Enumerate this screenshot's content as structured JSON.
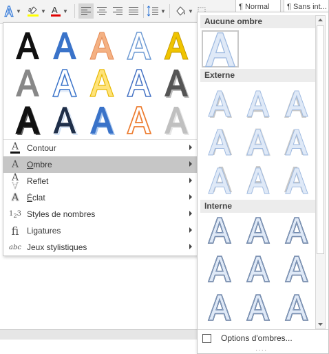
{
  "ribbon": {
    "styles_visible": [
      "¶ Normal",
      "¶ Sans int..."
    ],
    "buttons": [
      "text-effects",
      "highlight",
      "font-color",
      "align-left",
      "align-center",
      "align-right",
      "justify",
      "line-spacing",
      "shading",
      "borders"
    ],
    "colors": {
      "highlight": "#ffff00",
      "font_color": "#e00000",
      "accent": "#2e75d6"
    }
  },
  "menu": {
    "effects_gallery": {
      "rows": 3,
      "columns": 5
    },
    "items": [
      {
        "label": "Contour",
        "underline_char": "",
        "icon": "outline-A-icon",
        "active": false
      },
      {
        "label": "Ombre",
        "underline_char": "O",
        "icon": "shadow-A-icon",
        "active": true
      },
      {
        "label": "Reflet",
        "underline_char": "",
        "icon": "reflection-A-icon",
        "active": false
      },
      {
        "label": "Éclat",
        "underline_char": "É",
        "icon": "glow-A-icon",
        "active": false
      },
      {
        "label": "Styles de nombres",
        "underline_char": "",
        "icon": "number-styles-icon",
        "active": false
      },
      {
        "label": "Ligatures",
        "underline_char": "",
        "icon": "ligature-fi-icon",
        "active": false
      },
      {
        "label": "Jeux stylistiques",
        "underline_char": "",
        "icon": "stylistic-sets-icon",
        "active": false
      }
    ]
  },
  "flyout": {
    "sections": [
      "Aucune ombre",
      "Externe",
      "Interne"
    ],
    "options_label": "Options d'ombres..."
  }
}
